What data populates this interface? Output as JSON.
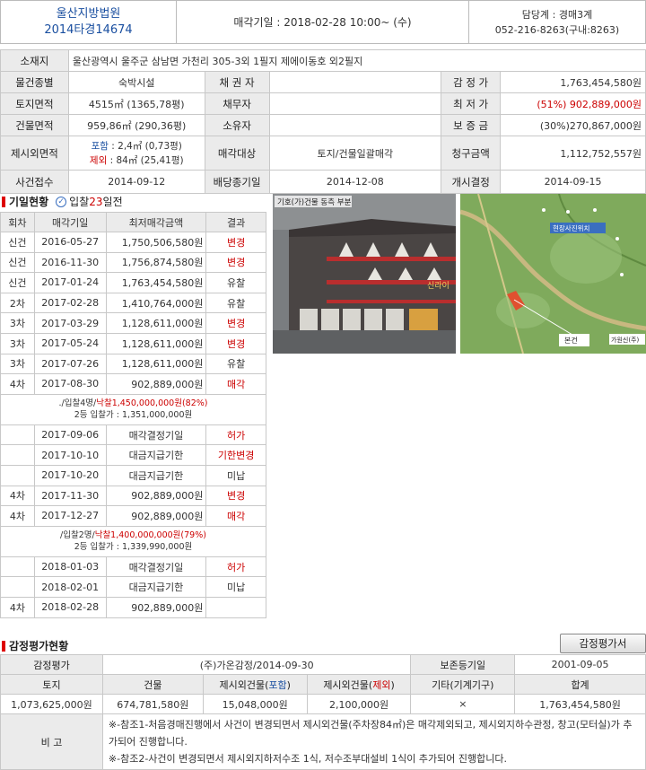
{
  "header": {
    "court": "울산지방법원",
    "case_no": "2014타경14674",
    "sale_date": "매각기일 : 2018-02-28  10:00~ (수)",
    "dept": "담당계 : 경매3계",
    "phone": "052-216-8263(구내:8263)"
  },
  "info": {
    "location_label": "소재지",
    "location_value": "울산광역시 울주군 삼남면 가천리 305-3외 1필지 제에이동호 외2필지",
    "type_label": "물건종별",
    "type_value": "숙박시설",
    "creditor_label": "채 권 자",
    "creditor_value": "",
    "appraisal_label": "감 정 가",
    "appraisal_value": "1,763,454,580원",
    "land_label": "토지면적",
    "land_value": "4515㎡ (1365,78평)",
    "debtor_label": "채무자",
    "debtor_value": "",
    "min_label": "최 저 가",
    "min_value": "(51%) 902,889,000원",
    "bldg_label": "건물면적",
    "bldg_value": "959,86㎡ (290,36평)",
    "owner_label": "소유자",
    "owner_value": "",
    "deposit_label": "보 증 금",
    "deposit_value": "(30%)270,867,000원",
    "excl_label": "제시외면적",
    "excl_inc_tag": "포함",
    "excl_inc_value": " : 2,4㎡ (0,73평)",
    "excl_exc_tag": "제외",
    "excl_exc_value": " : 84㎡ (25,41평)",
    "target_label": "매각대상",
    "target_value": "토지/건물일괄매각",
    "claim_label": "청구금액",
    "claim_value": "1,112,752,557원",
    "receipt_label": "사건접수",
    "receipt_value": "2014-09-12",
    "dividend_label": "배당종기일",
    "dividend_value": "2014-12-08",
    "start_label": "개시결정",
    "start_value": "2014-09-15"
  },
  "history": {
    "title": "기일현황",
    "dday_prefix": "입찰",
    "dday_num": "23",
    "dday_suffix": "일전",
    "headers": [
      "회차",
      "매각기일",
      "최저매각금액",
      "결과"
    ],
    "rows": [
      {
        "round": "신건",
        "date": "2016-05-27",
        "amount": "1,750,506,580원",
        "result": "변경",
        "red": true
      },
      {
        "round": "신건",
        "date": "2016-11-30",
        "amount": "1,756,874,580원",
        "result": "변경",
        "red": true
      },
      {
        "round": "신건",
        "date": "2017-01-24",
        "amount": "1,763,454,580원",
        "result": "유찰",
        "red": false
      },
      {
        "round": "2차",
        "date": "2017-02-28",
        "amount": "1,410,764,000원",
        "result": "유찰",
        "red": false
      },
      {
        "round": "3차",
        "date": "2017-03-29",
        "amount": "1,128,611,000원",
        "result": "변경",
        "red": true
      },
      {
        "round": "3차",
        "date": "2017-05-24",
        "amount": "1,128,611,000원",
        "result": "변경",
        "red": true
      },
      {
        "round": "3차",
        "date": "2017-07-26",
        "amount": "1,128,611,000원",
        "result": "유찰",
        "red": false
      },
      {
        "round": "4차",
        "date": "2017-08-30",
        "amount": "902,889,000원",
        "result": "매각",
        "red": true
      },
      {
        "note1_pre": "./입찰4명/",
        "note1_red": "낙찰1,450,000,000원(82%)",
        "note2": "2등 입찰가 : 1,351,000,000원"
      },
      {
        "round": "",
        "date": "2017-09-06",
        "amount": "매각결정기일",
        "result": "허가",
        "red": true
      },
      {
        "round": "",
        "date": "2017-10-10",
        "amount": "대금지급기한",
        "result": "기한변경",
        "red": true
      },
      {
        "round": "",
        "date": "2017-10-20",
        "amount": "대금지급기한",
        "result": "미납",
        "red": false
      },
      {
        "round": "4차",
        "date": "2017-11-30",
        "amount": "902,889,000원",
        "result": "변경",
        "red": true
      },
      {
        "round": "4차",
        "date": "2017-12-27",
        "amount": "902,889,000원",
        "result": "매각",
        "red": true
      },
      {
        "note1_pre": "/입찰2명/",
        "note1_red": "낙찰1,400,000,000원(79%)",
        "note2": "2등 입찰가 : 1,339,990,000원"
      },
      {
        "round": "",
        "date": "2018-01-03",
        "amount": "매각결정기일",
        "result": "허가",
        "red": true
      },
      {
        "round": "",
        "date": "2018-02-01",
        "amount": "대금지급기한",
        "result": "미납",
        "red": false
      },
      {
        "round": "4차",
        "date": "2018-02-28",
        "amount": "902,889,000원",
        "result": "",
        "red": false
      }
    ]
  },
  "photo": {
    "caption": "기호(가)건물 동측 부분",
    "sign": "신라이"
  },
  "map": {
    "marker": "현장사진위치",
    "label": "본건",
    "corner": "가원신(주)"
  },
  "appraisal": {
    "title": "감정평가현황",
    "button": "감정평가서",
    "row1": {
      "l1": "감정평가",
      "v1": "(주)가온감정/2014-09-30",
      "l2": "보존등기일",
      "v2": "2001-09-05"
    },
    "headers": [
      "토지",
      "건물",
      "제시외건물(",
      "포함",
      ")",
      "제시외건물(",
      "제외",
      ")",
      "기타(기계기구)",
      "합계"
    ],
    "values": [
      "1,073,625,000원",
      "674,781,580원",
      "15,048,000원",
      "2,100,000원",
      "×",
      "1,763,454,580원"
    ],
    "note_label": "비 고",
    "notes": [
      "※-참조1-처음경매진행에서 사건이 변경되면서 제시외건물(주차장84㎡)은 매각제외되고, 제시외지하수관정, 창고(모터실)가 추가되어 진행합니다.",
      "※-참조2-사건이 변경되면서 제시외지하저수조 1식, 저수조부대설비 1식이 추가되어 진행합니다."
    ]
  },
  "colors": {
    "accent_red": "#cc0000",
    "accent_blue": "#1a4fa0",
    "label_bg": "#ebebeb"
  }
}
